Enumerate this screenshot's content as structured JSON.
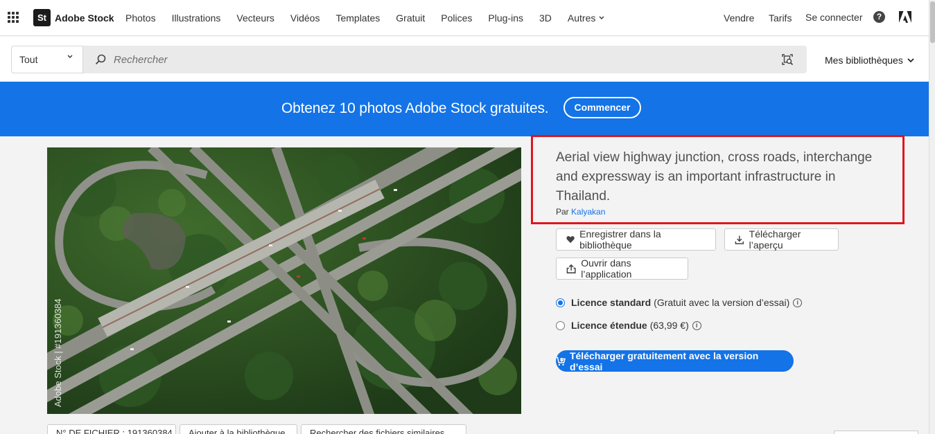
{
  "brand": {
    "logo": "St",
    "name": "Adobe Stock"
  },
  "nav": {
    "links": [
      "Photos",
      "Illustrations",
      "Vecteurs",
      "Vidéos",
      "Templates",
      "Gratuit",
      "Polices",
      "Plug-ins",
      "3D",
      "Autres"
    ],
    "sell": "Vendre",
    "pricing": "Tarifs",
    "signin": "Se connecter"
  },
  "search": {
    "scope": "Tout",
    "placeholder": "Rechercher",
    "libraries": "Mes bibliothèques"
  },
  "banner": {
    "text": "Obtenez 10 photos Adobe Stock gratuites.",
    "button": "Commencer",
    "color": "#1473e6"
  },
  "asset": {
    "watermark": "Adobe Stock | #191360384",
    "title": "Aerial view highway junction, cross roads, interchange and expressway is an important infrastructure in Thailand.",
    "author_prefix": "Par",
    "author": "Kalyakan"
  },
  "actions": {
    "save": "Enregistrer dans la bibliothèque",
    "preview": "Télécharger l’aperçu",
    "open_app": "Ouvrir dans l’application"
  },
  "license": {
    "standard_label": "Licence standard",
    "standard_note": "(Gratuit avec la version d’essai)",
    "extended_label": "Licence étendue",
    "extended_note": "(63,99 €)",
    "selected": "standard"
  },
  "download": {
    "label": "Télécharger gratuitement avec la version d’essai"
  },
  "bottom": {
    "file_no": "N° DE FICHIER : 191360384",
    "add_to": "Ajouter à la bibliothèque",
    "find_similar": "Rechercher des fichiers similaires"
  },
  "colors": {
    "accent": "#1473e6",
    "highlight": "#e0141e"
  }
}
